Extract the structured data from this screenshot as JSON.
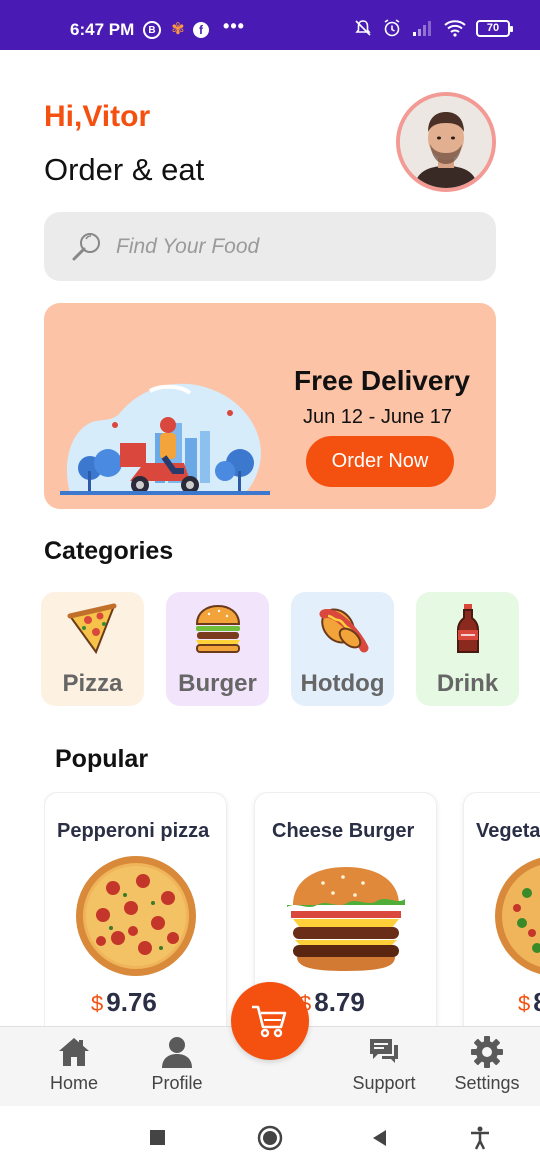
{
  "status_bar": {
    "time": "6:47 PM",
    "battery": "70",
    "icons": [
      "b-icon",
      "k-icon",
      "facebook-icon",
      "more-dots-icon",
      "mute-icon",
      "alarm-icon",
      "signal-icon",
      "wifi-icon",
      "battery-icon"
    ]
  },
  "header": {
    "greeting": "Hi,Vitor",
    "subtitle": "Order & eat"
  },
  "search": {
    "placeholder": "Find Your Food"
  },
  "banner": {
    "title": "Free Delivery",
    "dates": "Jun 12 - June 17",
    "button_label": "Order Now"
  },
  "categories": {
    "title": "Categories",
    "items": [
      {
        "label": "Pizza",
        "icon": "pizza-icon",
        "bg": "#fdf1e2"
      },
      {
        "label": "Burger",
        "icon": "burger-icon",
        "bg": "#f1e4fb"
      },
      {
        "label": "Hotdog",
        "icon": "hotdog-icon",
        "bg": "#e4effc"
      },
      {
        "label": "Drink",
        "icon": "drink-icon",
        "bg": "#e6f9e2"
      }
    ]
  },
  "popular": {
    "title": "Popular",
    "currency": "$",
    "items": [
      {
        "name": "Pepperoni pizza",
        "price": "9.76"
      },
      {
        "name": "Cheese Burger",
        "price": "8.79"
      },
      {
        "name": "Vegeta",
        "price": "8"
      }
    ]
  },
  "bottom_nav": {
    "items": [
      {
        "label": "Home",
        "icon": "home-icon"
      },
      {
        "label": "Profile",
        "icon": "profile-icon"
      },
      {
        "label": "Support",
        "icon": "support-icon"
      },
      {
        "label": "Settings",
        "icon": "settings-icon"
      }
    ],
    "cart_icon": "cart-icon"
  },
  "colors": {
    "accent": "#f4500f",
    "status_bar": "#4a1ab4",
    "banner_bg": "#fdc3a6",
    "text_dark": "#2a2f45"
  }
}
